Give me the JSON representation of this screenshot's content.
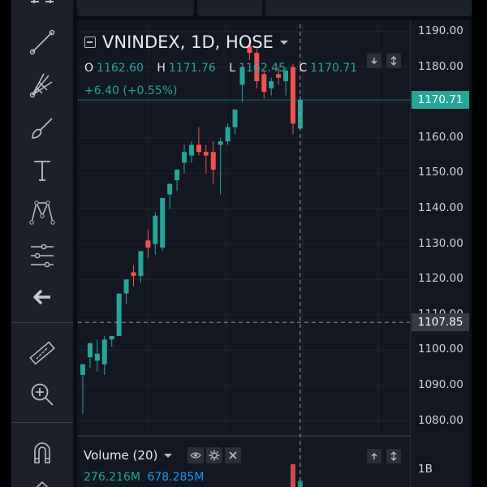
{
  "header": {
    "symbol_title": "VNINDEX, 1D, HOSE",
    "strip_text": "VNINDEX"
  },
  "ohlc": {
    "o_label": "O",
    "o_value": "1162.60",
    "h_label": "H",
    "h_value": "1171.76",
    "l_label": "L",
    "l_value": "1162.45",
    "c_label": "C",
    "c_value": "1170.71",
    "change": "+6.40 (+0.55%)"
  },
  "price_axis": {
    "ticks": [
      "1190.00",
      "1180.00",
      "1170.00",
      "1160.00",
      "1150.00",
      "1140.00",
      "1130.00",
      "1120.00",
      "1110.00",
      "1100.00",
      "1090.00",
      "1080.00"
    ],
    "last_price_label": "1170.71",
    "crosshair_price_label": "1107.85"
  },
  "volume": {
    "title": "Volume (20)",
    "value": "276.216M",
    "ma_value": "678.285M",
    "axis_tick": "1B"
  },
  "colors": {
    "up": "#26a69a",
    "down": "#ef5350",
    "background": "#131722",
    "sidebar": "#1c2129",
    "last_price": "#26a69a",
    "crosshair_tag": "#363a45",
    "ma": "#2196f3"
  },
  "toolbar": {
    "icons": [
      "trend-line-icon",
      "fib-pitchfork-icon",
      "brush-icon",
      "text-icon",
      "pattern-icon",
      "measure-tool-icon",
      "back-arrow-icon",
      "ruler-icon",
      "zoom-in-icon",
      "magnet-icon"
    ]
  },
  "chart_data": {
    "type": "candlestick",
    "title": "VNINDEX, 1D, HOSE",
    "ylim": [
      1075,
      1195
    ],
    "candles": [
      {
        "o": 1093,
        "h": 1096,
        "l": 1082,
        "c": 1096
      },
      {
        "o": 1098,
        "h": 1102,
        "l": 1095,
        "c": 1102
      },
      {
        "o": 1097,
        "h": 1103,
        "l": 1094,
        "c": 1099
      },
      {
        "o": 1096,
        "h": 1104,
        "l": 1093,
        "c": 1103
      },
      {
        "o": 1103,
        "h": 1104,
        "l": 1101,
        "c": 1104
      },
      {
        "o": 1104,
        "h": 1116,
        "l": 1104,
        "c": 1116
      },
      {
        "o": 1116,
        "h": 1120,
        "l": 1113,
        "c": 1120
      },
      {
        "o": 1122,
        "h": 1124,
        "l": 1118,
        "c": 1121
      },
      {
        "o": 1121,
        "h": 1128,
        "l": 1119,
        "c": 1128
      },
      {
        "o": 1131,
        "h": 1134,
        "l": 1126,
        "c": 1129
      },
      {
        "o": 1130,
        "h": 1139,
        "l": 1127,
        "c": 1138
      },
      {
        "o": 1129,
        "h": 1143,
        "l": 1128,
        "c": 1143
      },
      {
        "o": 1144,
        "h": 1147,
        "l": 1140,
        "c": 1147
      },
      {
        "o": 1148,
        "h": 1151,
        "l": 1145,
        "c": 1151
      },
      {
        "o": 1153,
        "h": 1158,
        "l": 1150,
        "c": 1156
      },
      {
        "o": 1155,
        "h": 1159,
        "l": 1153,
        "c": 1158
      },
      {
        "o": 1158,
        "h": 1163,
        "l": 1155,
        "c": 1156
      },
      {
        "o": 1156,
        "h": 1158,
        "l": 1150,
        "c": 1155
      },
      {
        "o": 1156,
        "h": 1159,
        "l": 1147,
        "c": 1151
      },
      {
        "o": 1158,
        "h": 1160,
        "l": 1144,
        "c": 1159
      },
      {
        "o": 1159,
        "h": 1164,
        "l": 1158,
        "c": 1163
      },
      {
        "o": 1163,
        "h": 1168,
        "l": 1161,
        "c": 1168
      },
      {
        "o": 1175,
        "h": 1180,
        "l": 1170,
        "c": 1180
      },
      {
        "o": 1186,
        "h": 1188,
        "l": 1182,
        "c": 1184
      },
      {
        "o": 1184,
        "h": 1185,
        "l": 1174,
        "c": 1176
      },
      {
        "o": 1178,
        "h": 1179,
        "l": 1171,
        "c": 1173
      },
      {
        "o": 1174,
        "h": 1177,
        "l": 1172,
        "c": 1176
      },
      {
        "o": 1178,
        "h": 1180,
        "l": 1175,
        "c": 1177
      },
      {
        "o": 1176,
        "h": 1180,
        "l": 1172,
        "c": 1179
      },
      {
        "o": 1180,
        "h": 1181,
        "l": 1161,
        "c": 1164
      },
      {
        "o": 1162.6,
        "h": 1171.76,
        "l": 1162.45,
        "c": 1170.71
      }
    ],
    "volume": [
      0,
      0,
      0,
      0,
      0,
      0,
      0,
      0,
      0,
      0,
      0,
      0,
      0,
      0,
      0,
      0,
      0,
      0,
      0,
      0,
      0,
      0,
      0,
      0,
      0,
      0,
      0,
      0,
      0,
      1.05,
      0.28
    ],
    "volume_ma": 0.678,
    "last_price": 1170.71,
    "crosshair_price": 1107.85
  }
}
